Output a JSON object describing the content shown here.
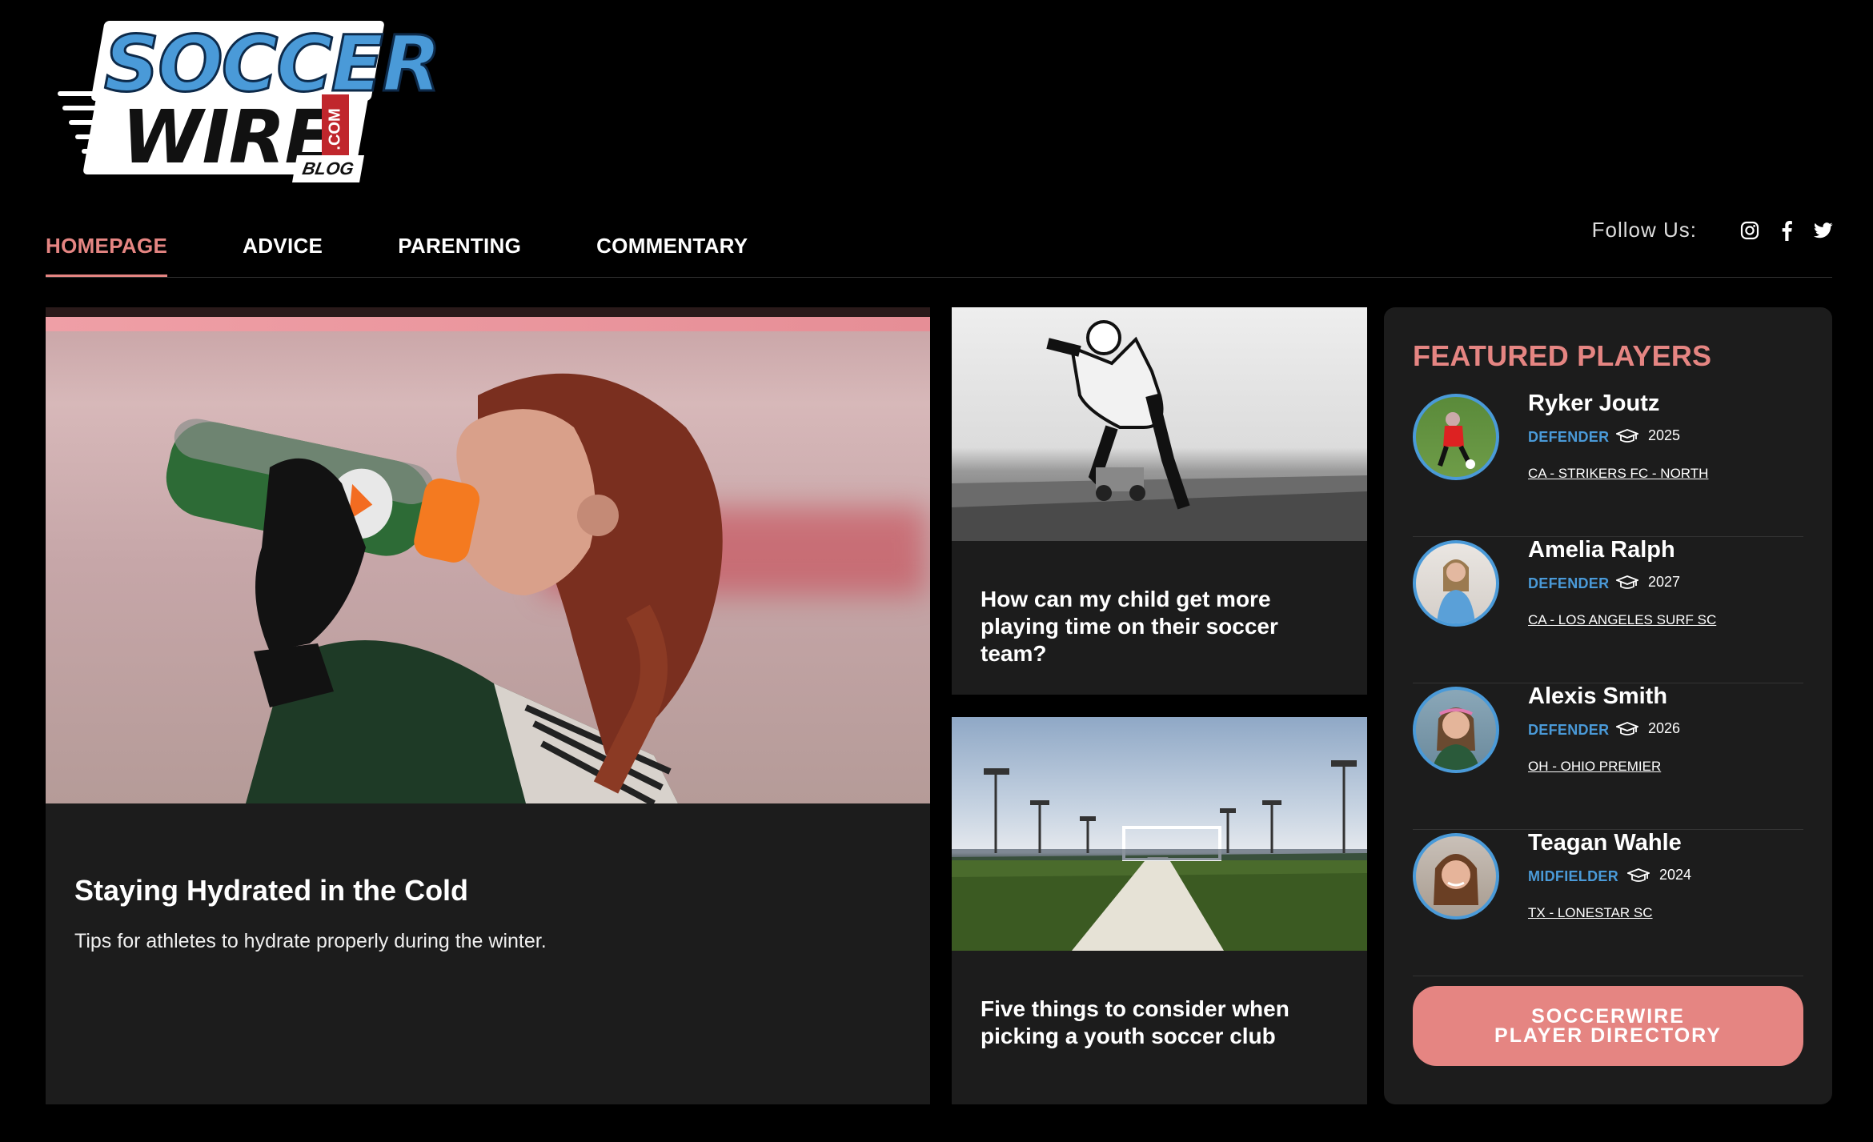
{
  "logo": {
    "line1": "SOCCER",
    "line2": "WIRE",
    "com": ".COM",
    "blog": "BLOG"
  },
  "nav": {
    "items": [
      {
        "label": "HOMEPAGE",
        "active": true
      },
      {
        "label": "ADVICE",
        "active": false
      },
      {
        "label": "PARENTING",
        "active": false
      },
      {
        "label": "COMMENTARY",
        "active": false
      }
    ],
    "follow_label": "Follow Us:",
    "social_icons": [
      "instagram-icon",
      "facebook-icon",
      "twitter-icon"
    ]
  },
  "main_article": {
    "title": "Staying Hydrated in the Cold",
    "description": "Tips for athletes to hydrate properly during the winter."
  },
  "side_articles": [
    {
      "title": "How can my child get more playing time on their soccer team?"
    },
    {
      "title": "Five things to consider when picking a youth soccer club"
    }
  ],
  "featured": {
    "title": "FEATURED PLAYERS",
    "players": [
      {
        "name": "Ryker Joutz",
        "position": "DEFENDER",
        "year": "2025",
        "club": "CA  - STRIKERS FC - NORTH"
      },
      {
        "name": "Amelia Ralph",
        "position": "DEFENDER",
        "year": "2027",
        "club": "CA  - LOS ANGELES SURF SC"
      },
      {
        "name": "Alexis Smith",
        "position": "DEFENDER",
        "year": "2026",
        "club": "OH  - OHIO PREMIER"
      },
      {
        "name": "Teagan Wahle",
        "position": "MIDFIELDER",
        "year": "2024",
        "club": "TX  - LONESTAR SC"
      }
    ],
    "directory_button": "SOCCERWIRE PLAYER DIRECTORY"
  },
  "colors": {
    "accent": "#e58582",
    "blue": "#4a9ad8",
    "card": "#1c1c1c",
    "background": "#000000"
  }
}
